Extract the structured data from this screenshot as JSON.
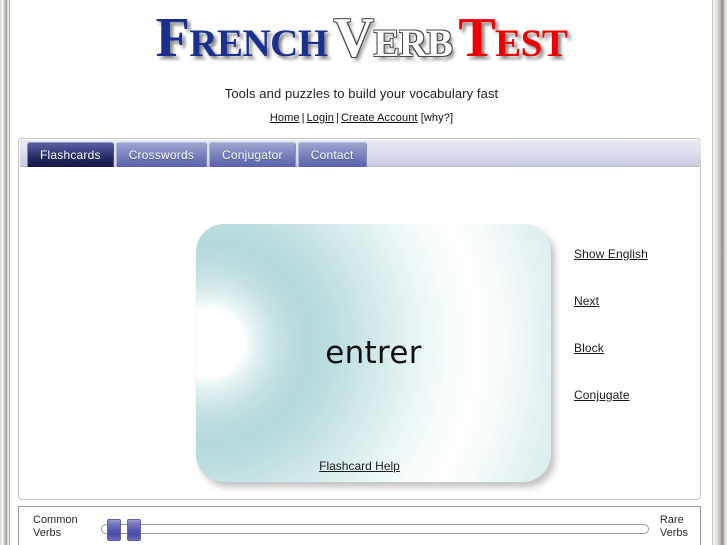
{
  "site": {
    "title_parts": {
      "first": "French",
      "second": "Verb",
      "third": "Test"
    },
    "tagline": "Tools and puzzles to build your vocabulary fast"
  },
  "topnav": {
    "items": [
      {
        "label": "Home"
      },
      {
        "label": "Login"
      },
      {
        "label": "Create Account"
      }
    ],
    "separator": "|",
    "why_label": "[why?]"
  },
  "tabs": [
    {
      "label": "Flashcards",
      "active": true
    },
    {
      "label": "Crosswords",
      "active": false
    },
    {
      "label": "Conjugator",
      "active": false
    },
    {
      "label": "Contact",
      "active": false
    }
  ],
  "flashcard": {
    "word": "entrer",
    "help_label": "Flashcard Help"
  },
  "actions": [
    {
      "label": "Show English"
    },
    {
      "label": "Next"
    },
    {
      "label": "Block"
    },
    {
      "label": "Conjugate"
    }
  ],
  "frequency_slider": {
    "left_label": "Common\nVerbs",
    "left_label_line1": "Common",
    "left_label_line2": "Verbs",
    "right_label_line1": "Rare",
    "right_label_line2": "Verbs",
    "handle_positions": [
      5,
      25
    ]
  },
  "colors": {
    "title_blue": "#1b2f8e",
    "title_red": "#ee0000",
    "tab_active": "#23265c",
    "tab_inactive": "#6d76b6",
    "slider_handle": "#4a4ca8",
    "card_teal": "#bfdcdc"
  }
}
